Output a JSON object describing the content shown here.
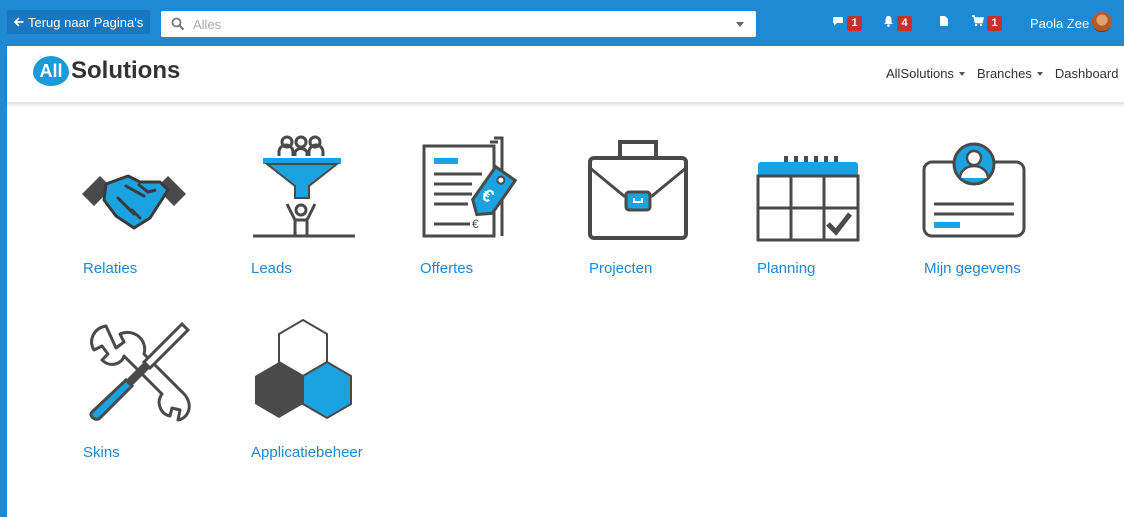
{
  "topbar": {
    "back_label": "Terug naar Pagina's",
    "search_placeholder": "Alles",
    "messages_count": "1",
    "notifications_count": "4",
    "cart_count": "1",
    "user_name": "Paola Zee"
  },
  "header": {
    "logo_mark": "All",
    "logo_text": "Solutions",
    "nav": [
      "AllSolutions",
      "Branches",
      "Dashboard"
    ]
  },
  "tiles": [
    {
      "label": "Relaties",
      "icon": "handshake-icon"
    },
    {
      "label": "Leads",
      "icon": "funnel-icon"
    },
    {
      "label": "Offertes",
      "icon": "quote-document-icon"
    },
    {
      "label": "Projecten",
      "icon": "briefcase-icon"
    },
    {
      "label": "Planning",
      "icon": "calendar-icon"
    },
    {
      "label": "Mijn gegevens",
      "icon": "id-card-icon"
    },
    {
      "label": "Skins",
      "icon": "tools-icon"
    },
    {
      "label": "Applicatiebeheer",
      "icon": "hexagons-icon"
    }
  ],
  "colors": {
    "primary": "#1e8ad6",
    "accent": "#1aa3e0",
    "icon_dark": "#4a4a4a",
    "badge": "#c9302c"
  }
}
